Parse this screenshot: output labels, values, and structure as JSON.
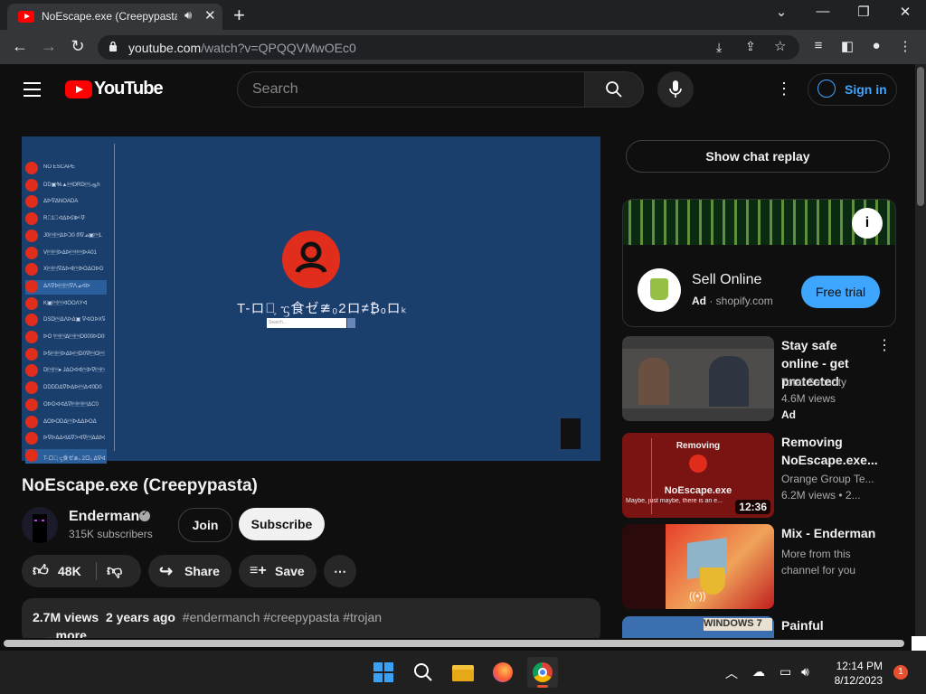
{
  "browser": {
    "tab_title": "NoEscape.exe (Creepypasta)",
    "tab_audio_icon": "speaker-icon",
    "tab_close": "✕",
    "new_tab": "+",
    "url_host": "youtube.com",
    "url_path": "/watch?v=QPQQVMwOEc0",
    "window_controls": [
      "⌄",
      "—",
      "❐",
      "✕"
    ]
  },
  "yt_header": {
    "logo_text": "YouTube",
    "search_placeholder": "Search",
    "sign_in": "Sign in"
  },
  "video_frame": {
    "app_title": "T-ロヴ᷊ ᠊ᦓ食ゼ≇₀2ロ≠₿ₒロₖ",
    "search_placeholder": "Search...",
    "sidebar_items": [
      {
        "label": "NO ESCAPE",
        "selected": false
      },
      {
        "label": "DD▣℁▲\u0001ORD\u0002ஆh",
        "selected": false
      },
      {
        "label": "ᐃ⁠ᐅᐁᐄ⁠NOA⁠DA",
        "selected": false
      },
      {
        "label": "R\u00001\u0002⁠ᐊᐃᐅᘏᐈᴸᐍ",
        "selected": false
      },
      {
        "label": "J0\u0002\u0002ᐃ⁠ᐅ⁠ᑐ0 ᗰᐁᓄ▣\u0002L",
        "selected": false
      },
      {
        "label": "V\u0002\u0002ᐅᐃ⁠ᐅ\u0002ᵒ\u0002ᐅ⁠A01",
        "selected": false
      },
      {
        "label": "X\u0002\u0002ᐁᐃᐅᐋ\u0002ᐅOᐃOᐅD",
        "selected": false
      },
      {
        "label": "ᐃᐱᐁᐅ\u0002\u0002ᐁᐱᓄᐊᐅ",
        "selected": true
      },
      {
        "label": "K▣\u0002\u0002ᐊOOᐱYᐊ",
        "selected": false
      },
      {
        "label": "DSD\u0002ᐃᐱᐅᐃ▣ ᐁ⁠ᐊOᐅXᐁ",
        "selected": false
      },
      {
        "label": "ᐅO ᵗ\u0002\u0002⁠ᐃ\u0002\u0002O000ᐅD0D",
        "selected": false
      },
      {
        "label": "ᐅ5\u0002\u0002ᐅ⁠ᐃ⁠ᐅ\u0002D0ᐁ\u0002O\u0002ᐃᐁ\u0002ᐃ0",
        "selected": false
      },
      {
        "label": "D\u0002\u0002● JᐃOᐊᐊ\u0002ᐅᐁ\u0002\u0002ᐁ\u0002\u0002ᐃ",
        "selected": false
      },
      {
        "label": "DDDDᐃᐁ⁠ᐅᐃᐅ\u0002ᐃᐊ0D0",
        "selected": false
      },
      {
        "label": "OᐅDᐊᐊ⁠ᐃᐁ⁠\u0002\u0002\u0002ᐃ⁠C0",
        "selected": false
      },
      {
        "label": "ᐃOᐅODᐃ\u0002ᐅᐃᐃᐅO⁠ᐃ",
        "selected": false
      },
      {
        "label": "ᐅᐁᐅᐃᐃᐊᐃᐁᐳ⁠ᐊᐁ\u0002ᐃ⁠ᐃᐅOO⁠ᐃ⁠ᐊOᐅ",
        "selected": false
      },
      {
        "label": "T-ロヴ᷊ ᠊ᦓ食ゼ≇₀ 2ロ₁ ᐃᐁᐊ",
        "selected": true
      }
    ]
  },
  "video_meta": {
    "title": "NoEscape.exe (Creepypasta)",
    "channel": "Enderman",
    "subscribers": "315K subscribers",
    "join": "Join",
    "subscribe": "Subscribe",
    "likes": "48K",
    "share": "Share",
    "save": "Save",
    "views": "2.7M views",
    "age": "2 years ago",
    "hashtags": "#endermanch #creepypasta #trojan",
    "more": "...more"
  },
  "sidebar": {
    "chat_replay": "Show chat replay",
    "ad": {
      "title": "Sell Online",
      "badge": "Ad",
      "domain": "shopify.com",
      "cta": "Free trial",
      "info_icon": "info-icon"
    },
    "recommendations": [
      {
        "title": "Stay safe online - get protected",
        "channel": "Total Security",
        "views": "4.6M views",
        "extra": "Ad",
        "duration": ""
      },
      {
        "title": "Removing NoEscape.exe...",
        "channel": "Orange Group Te...",
        "views": "6.2M views",
        "extra": "• 2...",
        "duration": "12:36",
        "thumb_title": "Removing",
        "thumb_caption": "NoEscape.exe",
        "thumb_sub": "Maybe, just maybe, there is an e..."
      },
      {
        "title": "Mix - Enderman",
        "channel": "More from this channel for you",
        "views": "",
        "extra": "",
        "duration": ""
      },
      {
        "title": "Painful",
        "channel": "",
        "views": "",
        "extra": "",
        "duration": "",
        "thumb_label": "WINDOWS 7"
      }
    ]
  },
  "taskbar": {
    "time": "12:14 PM",
    "date": "8/12/2023",
    "notification_count": "1",
    "apps": [
      "windows-start-icon",
      "search-icon",
      "file-explorer-icon",
      "firefox-icon",
      "chrome-icon"
    ]
  },
  "colors": {
    "yt_red": "#ff0000",
    "link_blue": "#3ea6ff",
    "video_bg": "#1b3f6d",
    "app_red": "#e02d1c"
  }
}
